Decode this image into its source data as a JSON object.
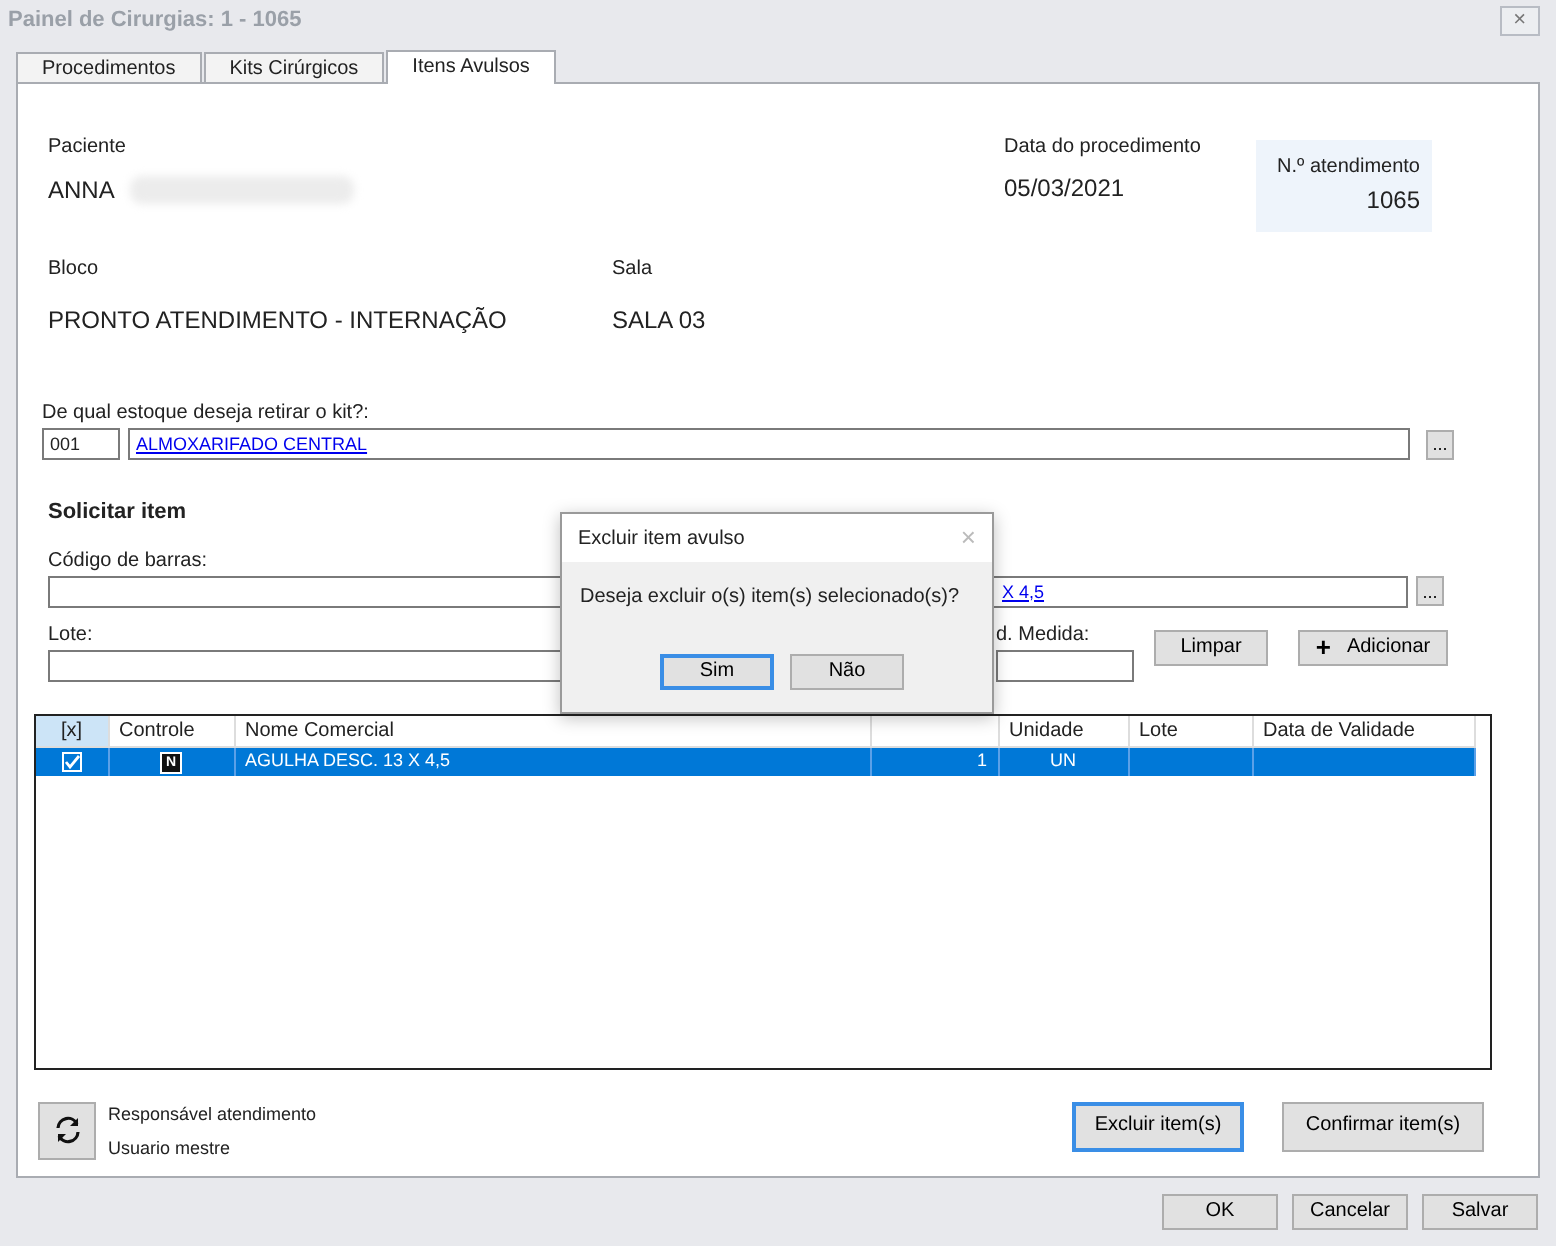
{
  "window": {
    "title": "Painel de Cirurgias: 1 - 1065",
    "close": "×"
  },
  "tabs": [
    {
      "label": "Procedimentos",
      "selected": false
    },
    {
      "label": "Kits Cirúrgicos",
      "selected": false
    },
    {
      "label": "Itens Avulsos",
      "selected": true
    }
  ],
  "patient": {
    "label": "Paciente",
    "value": "ANNA"
  },
  "procedure_date": {
    "label": "Data do procedimento",
    "value": "05/03/2021"
  },
  "attendance": {
    "label": "N.º atendimento",
    "value": "1065"
  },
  "block": {
    "label": "Bloco",
    "value": "PRONTO ATENDIMENTO - INTERNAÇÃO"
  },
  "room": {
    "label": "Sala",
    "value": "SALA 03"
  },
  "stock": {
    "label": "De qual estoque deseja retirar o kit?:",
    "code": "001",
    "name": "ALMOXARIFADO CENTRAL",
    "browse": "..."
  },
  "request": {
    "title": "Solicitar item",
    "barcode_label": "Código de barras:",
    "product_value": "X 4,5",
    "product_browse": "...",
    "lot_label": "Lote:",
    "unit_label": "d. Medida:",
    "clear": "Limpar",
    "add": "Adicionar",
    "add_icon": "+"
  },
  "table": {
    "columns": [
      "[x]",
      "Controle",
      "Nome Comercial",
      "Unidade",
      "Lote",
      "Data de Validade"
    ],
    "rows": [
      {
        "checked": true,
        "selected": true,
        "control": "N",
        "name": "AGULHA DESC. 13 X 4,5",
        "quantity": "1",
        "unit": "UN"
      }
    ]
  },
  "responsible": {
    "label": "Responsável atendimento",
    "value": "Usuario mestre"
  },
  "actions": [
    {
      "label": "Excluir item(s)",
      "focused": true
    },
    {
      "label": "Confirmar item(s)",
      "focused": false
    }
  ],
  "footer_buttons": [
    {
      "label": "OK"
    },
    {
      "label": "Cancelar"
    },
    {
      "label": "Salvar"
    }
  ],
  "dialog": {
    "title": "Excluir item avulso",
    "close": "×",
    "message": "Deseja excluir o(s) item(s) selecionado(s)?",
    "buttons": [
      {
        "label": "Sim",
        "focused": true
      },
      {
        "label": "Não",
        "focused": false
      }
    ]
  }
}
